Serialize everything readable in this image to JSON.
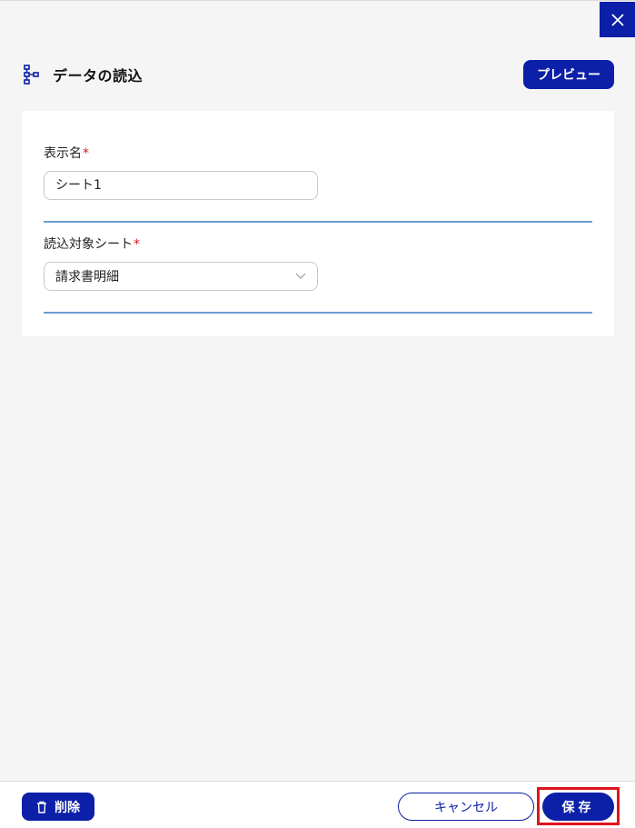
{
  "header": {
    "title": "データの読込",
    "icon": "flow-tree-icon",
    "preview_label": "プレビュー",
    "close_icon": "close-icon"
  },
  "form": {
    "display_name": {
      "label": "表示名",
      "required_mark": "*",
      "value": "シート1"
    },
    "target_sheet": {
      "label": "読込対象シート",
      "required_mark": "*",
      "selected": "請求書明細",
      "icon": "chevron-down-icon"
    }
  },
  "footer": {
    "delete_label": "削除",
    "delete_icon": "trash-icon",
    "cancel_label": "キャンセル",
    "save_label": "保存"
  },
  "colors": {
    "primary": "#0b1fa8",
    "required": "#d21e1e",
    "divider": "#6b9ecf",
    "highlight": "#e0141e",
    "background": "#f5f5f5"
  }
}
